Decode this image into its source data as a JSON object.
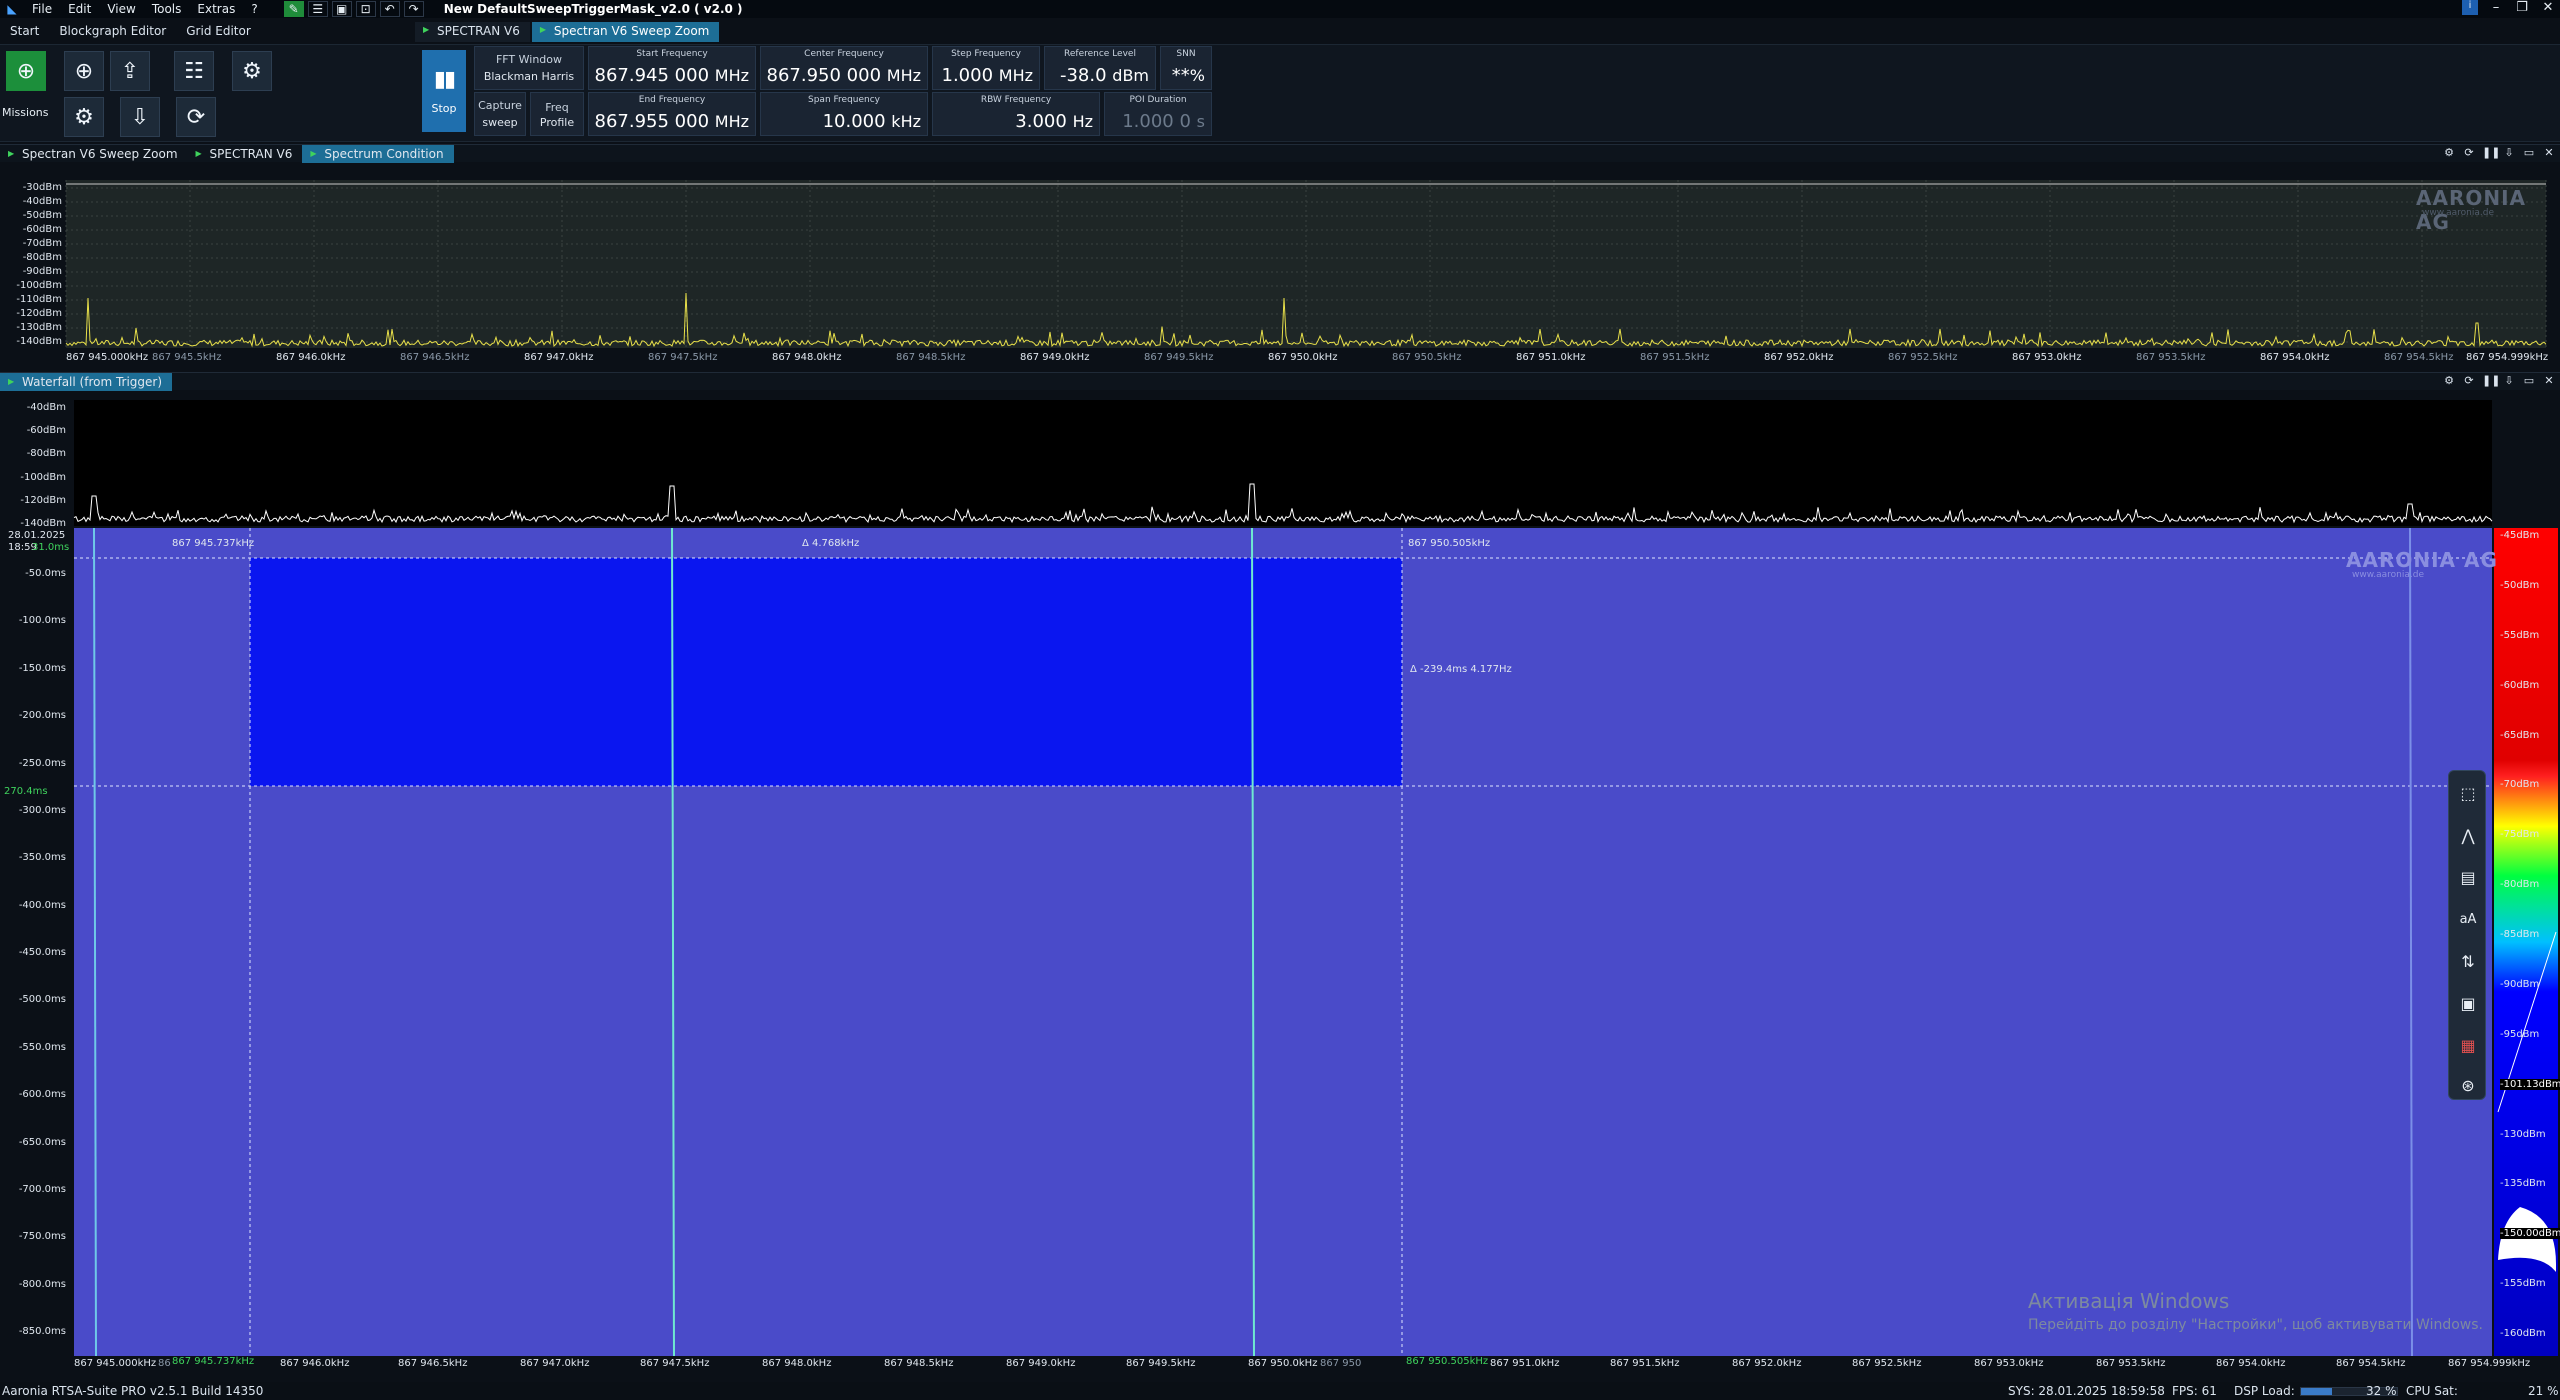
{
  "title_bar": {
    "menus": [
      "File",
      "Edit",
      "View",
      "Tools",
      "Extras",
      "?"
    ],
    "document_title": "New DefaultSweepTriggerMask_v2.0 ( v2.0 )",
    "window_controls": [
      "minimize-icon",
      "restore-icon",
      "maximize-icon",
      "close-icon"
    ]
  },
  "ribbon_tabs": [
    "Start",
    "Blockgraph Editor",
    "Grid Editor"
  ],
  "doc_tabs": [
    "SPECTRAN V6",
    "Spectran V6 Sweep Zoom"
  ],
  "toolbar": {
    "missions_label": "Missions",
    "stop_label": "Stop",
    "fft_window": {
      "label": "FFT Window",
      "value": "Blackman Harris"
    },
    "capture": {
      "label": "Capture",
      "value": "sweep"
    },
    "freq_profile": {
      "label1": "Freq",
      "label2": "Profile"
    },
    "start_frequency": {
      "label": "Start Frequency",
      "value": "867.945 000",
      "unit": "MHz"
    },
    "end_frequency": {
      "label": "End Frequency",
      "value": "867.955 000",
      "unit": "MHz"
    },
    "center_frequency": {
      "label": "Center Frequency",
      "value": "867.950 000",
      "unit": "MHz"
    },
    "span_frequency": {
      "label": "Span Frequency",
      "value": "10.000",
      "unit": "kHz"
    },
    "step_frequency": {
      "label": "Step Frequency",
      "value": "1.000",
      "unit": "MHz"
    },
    "rbw_frequency": {
      "label": "RBW Frequency",
      "value": "3.000",
      "unit": "Hz"
    },
    "reference_level": {
      "label": "Reference Level",
      "value": "-38.0",
      "unit": "dBm"
    },
    "poi_duration": {
      "label": "POI Duration",
      "value": "1.000 0",
      "unit": "s"
    },
    "snn": {
      "label": "SNN",
      "value": "**",
      "unit": "%"
    }
  },
  "spectrum_panel": {
    "tabs": [
      "Spectran V6 Sweep Zoom",
      "SPECTRAN V6",
      "Spectrum Condition"
    ],
    "y_labels": [
      "-30dBm",
      "-40dBm",
      "-50dBm",
      "-60dBm",
      "-70dBm",
      "-80dBm",
      "-90dBm",
      "-100dBm",
      "-110dBm",
      "-120dBm",
      "-130dBm",
      "-140dBm"
    ],
    "x_labels": [
      "867 945.000kHz",
      "867 945.5kHz",
      "867 946.0kHz",
      "867 946.5kHz",
      "867 947.0kHz",
      "867 947.5kHz",
      "867 948.0kHz",
      "867 948.5kHz",
      "867 949.0kHz",
      "867 949.5kHz",
      "867 950.0kHz",
      "867 950.5kHz",
      "867 951.0kHz",
      "867 951.5kHz",
      "867 952.0kHz",
      "867 952.5kHz",
      "867 953.0kHz",
      "867 953.5kHz",
      "867 954.0kHz",
      "867 954.5kHz",
      "867 954.999kHz"
    ],
    "logo": "AARONIA AG",
    "logo_url": "www.aaronia.de"
  },
  "waterfall_panel": {
    "tab": "Waterfall (from Trigger)",
    "spec_y_labels": [
      "-40dBm",
      "-60dBm",
      "-80dBm",
      "-100dBm",
      "-120dBm",
      "-140dBm"
    ],
    "date": "28.01.2025",
    "time": "18:59",
    "time_offset": "31.0ms",
    "marker_row_label": "270.4ms",
    "time_labels": [
      "-50.0ms",
      "-100.0ms",
      "-150.0ms",
      "-200.0ms",
      "-250.0ms",
      "-300.0ms",
      "-350.0ms",
      "-400.0ms",
      "-450.0ms",
      "-500.0ms",
      "-550.0ms",
      "-600.0ms",
      "-650.0ms",
      "-700.0ms",
      "-750.0ms",
      "-800.0ms",
      "-850.0ms"
    ],
    "marker_left": "867 945.737kHz",
    "marker_right": "867 950.505kHz",
    "delta_freq": "Δ 4.768kHz",
    "delta_time": "Δ -239.4ms 4.177Hz",
    "x_labels": [
      "867 945.000kHz",
      "867 946.0kHz",
      "867 946.5kHz",
      "867 947.0kHz",
      "867 947.5kHz",
      "867 948.0kHz",
      "867 948.5kHz",
      "867 949.0kHz",
      "867 949.5kHz",
      "867 950.0kHz",
      "867 951.0kHz",
      "867 951.5kHz",
      "867 952.0kHz",
      "867 952.5kHz",
      "867 953.0kHz",
      "867 953.5kHz",
      "867 954.0kHz",
      "867 954.5kHz",
      "867 954.999kHz"
    ],
    "x_marker_left": "867 945.737kHz",
    "x_marker_right": "867 950.505kHz",
    "x_marker_left_prefix": "86",
    "x_marker_right_prefix": "867 950",
    "colorbar_labels": [
      "-45dBm",
      "-50dBm",
      "-55dBm",
      "-60dBm",
      "-65dBm",
      "-70dBm",
      "-75dBm",
      "-80dBm",
      "-85dBm",
      "-90dBm",
      "-95dBm",
      "-101.13dBm",
      "-130dBm",
      "-135dBm",
      "-150.00dBm",
      "-155dBm",
      "-160dBm"
    ],
    "logo": "AARONIA AG",
    "logo_url": "www.aaronia.de"
  },
  "windows_activation": {
    "title": "Активація Windows",
    "subtitle": "Перейдіть до розділу \"Настройки\", щоб активувати Windows."
  },
  "status_bar": {
    "build": "Aaronia RTSA-Suite PRO v2.5.1 Build 14350",
    "sys": "SYS: 28.01.2025 18:59:58",
    "fps": "FPS: 61",
    "dsp_label": "DSP Load:",
    "dsp_value": "32 %",
    "dsp_fraction": 0.32,
    "cpu_label": "CPU Sat:",
    "cpu_value": "21 %"
  },
  "colors": {
    "waterfall_bg": "#4a4bc9",
    "marker_region": "#0a16f0",
    "spectrum_trace": "#e8e04a",
    "accent": "#1d6e96"
  }
}
